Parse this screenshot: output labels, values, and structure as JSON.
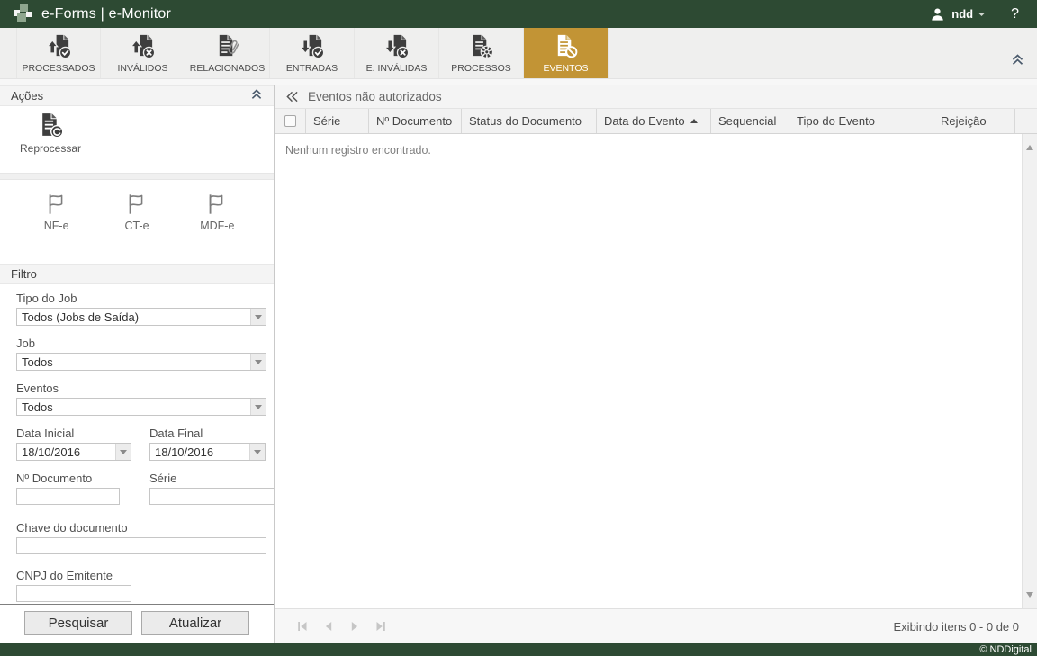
{
  "topbar": {
    "title": "e-Forms | e-Monitor",
    "username": "ndd",
    "help_label": "?",
    "icons": {
      "logo": "ndd-squares-logo",
      "user": "user-silhouette-icon",
      "caret": "chevron-down-icon",
      "help": "question-mark-icon"
    }
  },
  "toolbar": {
    "collapse_icon": "double-chevron-up-icon",
    "tabs": [
      {
        "label": "PROCESSADOS",
        "icon": "doc-upload-check-icon",
        "active": false
      },
      {
        "label": "INVÁLIDOS",
        "icon": "doc-upload-x-icon",
        "active": false
      },
      {
        "label": "RELACIONADOS",
        "icon": "doc-paperclip-icon",
        "active": false
      },
      {
        "label": "ENTRADAS",
        "icon": "doc-download-check-icon",
        "active": false
      },
      {
        "label": "E. INVÁLIDAS",
        "icon": "doc-download-x-icon",
        "active": false
      },
      {
        "label": "PROCESSOS",
        "icon": "doc-gear-icon",
        "active": false
      },
      {
        "label": "EVENTOS",
        "icon": "doc-blocked-icon",
        "active": true
      }
    ]
  },
  "sidebar": {
    "actions": {
      "header": "Ações",
      "collapse_icon": "double-chevron-up-icon",
      "reprocess_label": "Reprocessar",
      "reprocess_icon": "doc-refresh-icon",
      "flags": [
        {
          "label": "NF-e",
          "icon": "flag-outline-icon"
        },
        {
          "label": "CT-e",
          "icon": "flag-outline-icon"
        },
        {
          "label": "MDF-e",
          "icon": "flag-outline-icon"
        }
      ]
    },
    "filter": {
      "header": "Filtro",
      "tipo_do_job": {
        "label": "Tipo do Job",
        "value": "Todos (Jobs de Saída)"
      },
      "job": {
        "label": "Job",
        "value": "Todos"
      },
      "eventos": {
        "label": "Eventos",
        "value": "Todos"
      },
      "data_inicial": {
        "label": "Data Inicial",
        "value": "18/10/2016"
      },
      "data_final": {
        "label": "Data Final",
        "value": "18/10/2016"
      },
      "numero_documento": {
        "label": "Nº Documento",
        "value": ""
      },
      "serie": {
        "label": "Série",
        "value": ""
      },
      "chave_documento": {
        "label": "Chave do documento",
        "value": ""
      },
      "cnpj_emitente": {
        "label": "CNPJ do Emitente",
        "value": ""
      },
      "search_button": "Pesquisar",
      "refresh_button": "Atualizar"
    }
  },
  "main": {
    "back_icon": "double-chevron-left-icon",
    "header_title": "Eventos não autorizados",
    "table": {
      "columns": [
        "Série",
        "Nº Documento",
        "Status do Documento",
        "Data do Evento",
        "Sequencial",
        "Tipo do Evento",
        "Rejeição"
      ],
      "sorted_column": "Data do Evento",
      "sort_direction": "asc",
      "empty_message": "Nenhum registro encontrado.",
      "rows": []
    },
    "pagination": {
      "icons": [
        "first-page-icon",
        "prev-page-icon",
        "next-page-icon",
        "last-page-icon"
      ],
      "status": "Exibindo itens 0 - 0 de 0"
    }
  },
  "footer": {
    "copyright": "© NDDigital"
  },
  "colors": {
    "brand_green": "#2d4a33",
    "active_tab_gold": "#c29435",
    "icon_dark": "#3e3e3e"
  }
}
